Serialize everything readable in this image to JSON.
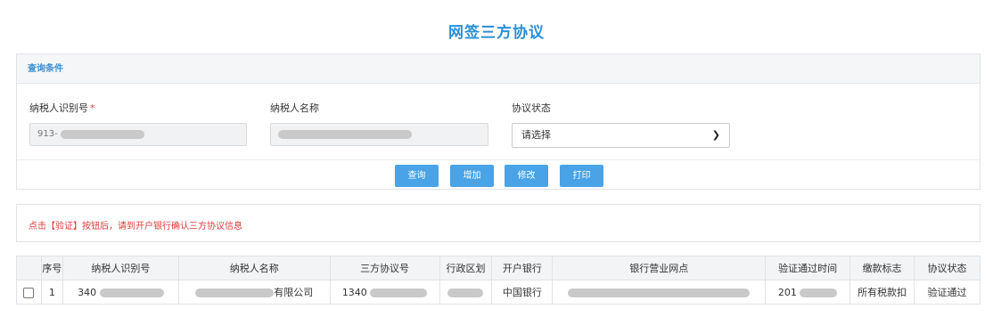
{
  "page": {
    "title": "网签三方协议"
  },
  "query": {
    "header": "查询条件",
    "taxpayer_id": {
      "label": "纳税人识别号",
      "required_mark": "*",
      "value": "913-"
    },
    "taxpayer_name": {
      "label": "纳税人名称",
      "value": ""
    },
    "agreement_status": {
      "label": "协议状态",
      "selected": "请选择"
    },
    "buttons": {
      "query": "查询",
      "add": "增加",
      "modify": "修改",
      "print": "打印"
    }
  },
  "notice": {
    "text": "点击【验证】按钮后，请到开户银行确认三方协议信息"
  },
  "table": {
    "headers": [
      "序号",
      "纳税人识别号",
      "纳税人名称",
      "三方协议号",
      "行政区划",
      "开户银行",
      "银行营业网点",
      "验证通过时间",
      "缴款标志",
      "协议状态"
    ],
    "rows": [
      {
        "index": "1",
        "taxpayer_id": "340",
        "taxpayer_name": "有限公司",
        "agreement_no": "1340",
        "region": "",
        "bank": "中国银行",
        "branch": "",
        "verify_time": "201",
        "payment_flag": "所有税款扣",
        "status": "验证通过"
      }
    ]
  },
  "colors": {
    "accent": "#2a8fd6",
    "button": "#4aa3e6",
    "notice": "#e03a3a"
  }
}
